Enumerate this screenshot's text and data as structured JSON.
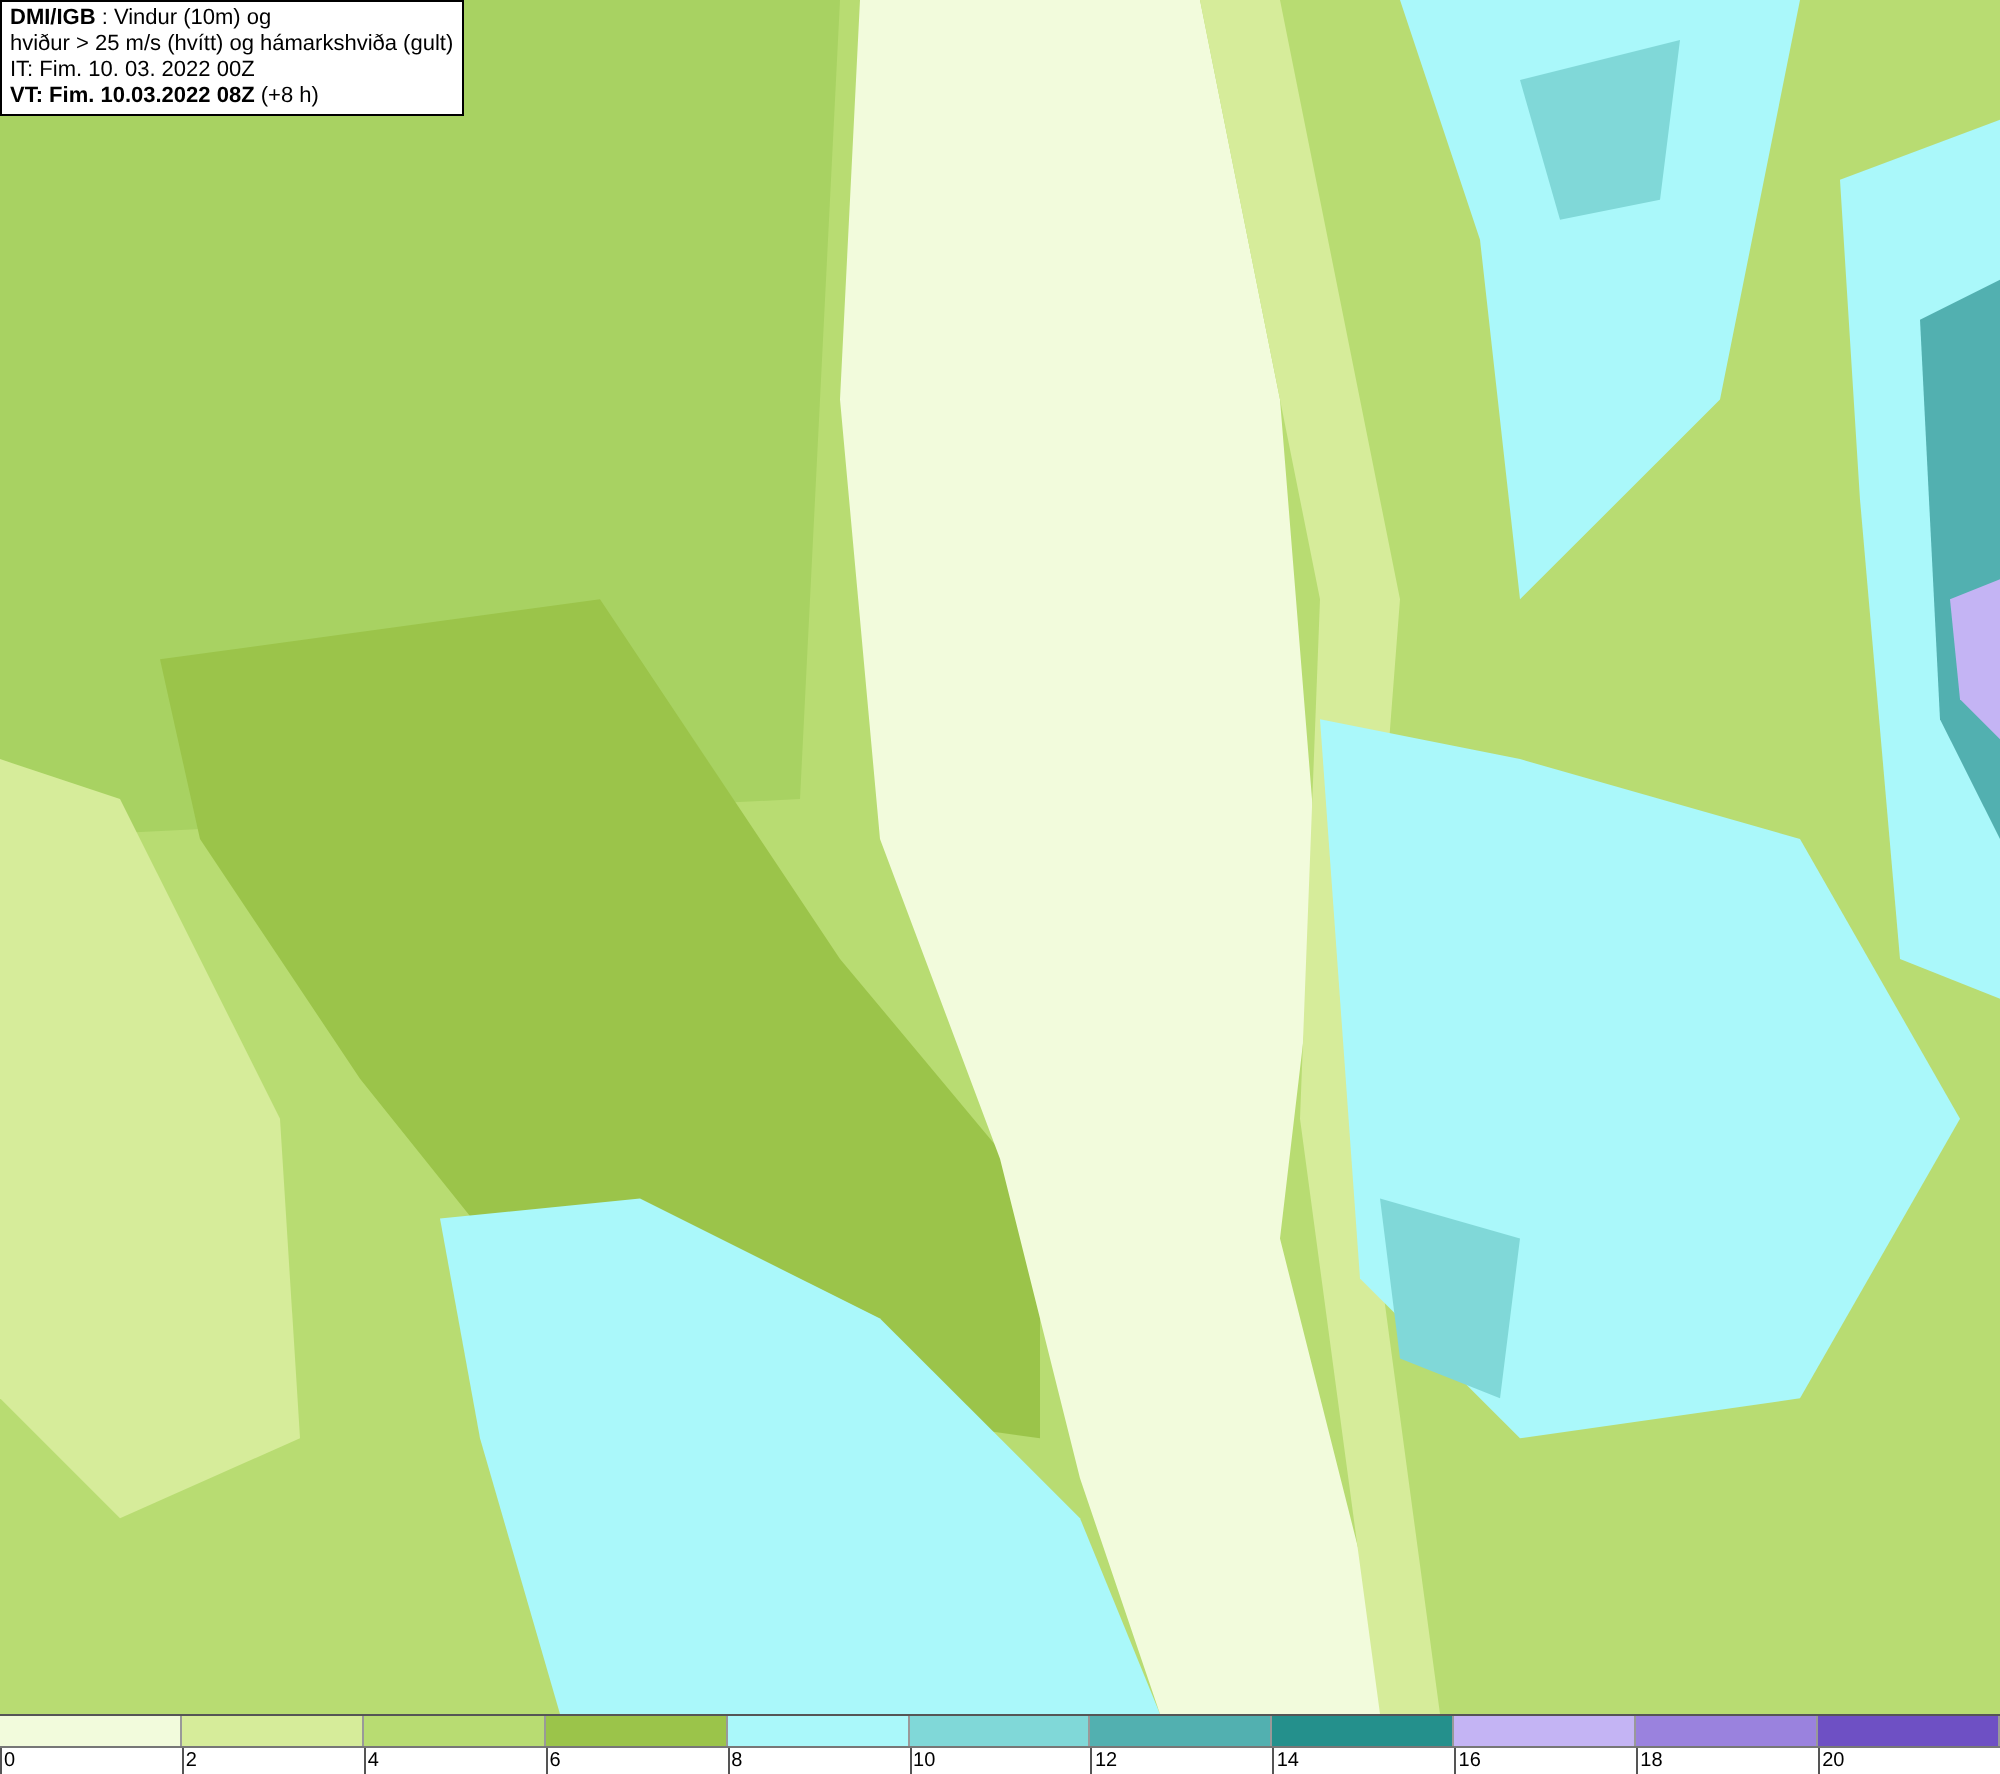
{
  "info_box": {
    "lines": [
      "**DMI/IGB** : Vindur (10m) og",
      "hviður > 25 m/s (hvítt) og hámarkshviða (gult)",
      "IT: Fim. 10. 03. 2022 00Z",
      "**VT: Fim. 10.03.2022 08Z** (+8 h)"
    ]
  },
  "legend": {
    "segments": [
      {
        "color": "#f2fbdc"
      },
      {
        "color": "#d6ec9a"
      },
      {
        "color": "#b8dc72"
      },
      {
        "color": "#9bc44a"
      },
      {
        "color": "#aaf8fa"
      },
      {
        "color": "#80d8d8"
      },
      {
        "color": "#52b0b0"
      },
      {
        "color": "#24908c"
      },
      {
        "color": "#c4b4f4"
      },
      {
        "color": "#9a82de"
      },
      {
        "color": "#6e50c4"
      }
    ],
    "ticks": [
      "0",
      "2",
      "4",
      "6",
      "8",
      "10",
      "12",
      "14",
      "16",
      "18",
      "20"
    ]
  }
}
